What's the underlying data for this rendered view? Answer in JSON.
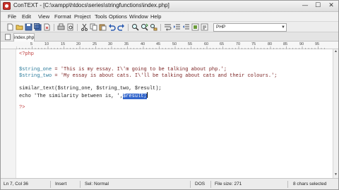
{
  "window": {
    "title": "ConTEXT - [C:\\xampp\\htdocs\\series\\stringfunctions\\index.php]",
    "minimize_glyph": "—",
    "maximize_glyph": "☐",
    "close_glyph": "✕"
  },
  "menu": {
    "items": [
      "File",
      "Edit",
      "View",
      "Format",
      "Project",
      "Tools",
      "Options",
      "Window",
      "Help"
    ]
  },
  "toolbar": {
    "language": "PHP",
    "dropdown_glyph": "▼"
  },
  "tabs": [
    {
      "label": "index.php"
    }
  ],
  "ruler": {
    "marks": [
      "5",
      "10",
      "15",
      "20",
      "25",
      "30",
      "35",
      "40",
      "45",
      "50",
      "55",
      "60",
      "65",
      "70",
      "75",
      "80",
      "85",
      "90",
      "95"
    ]
  },
  "editor": {
    "line1": "<?php",
    "line3_var": "$string_one",
    "line3_rest": " = 'This is my essay. I\\'m going to be talking about php.';",
    "line4_var": "$string_two",
    "line4_rest": " = 'My essay is about cats. I\\'ll be talking about cats and their colours.';",
    "line6": "similar_text($string_one, $string_two, $result);",
    "line7_text": "echo 'The similarity between is, ',",
    "line7_selected": "$result;",
    "line9": "?>"
  },
  "status": {
    "position": "Ln 7, Col 36",
    "mode": "Insert",
    "selection": "Sel: Normal",
    "format": "DOS",
    "file_size": "File size: 271",
    "selected_chars": "8 chars selected"
  },
  "colors": {
    "selection": "#3366cc",
    "variable": "#2a7a9a",
    "string": "#7a2020",
    "php_tag": "#c04040"
  }
}
